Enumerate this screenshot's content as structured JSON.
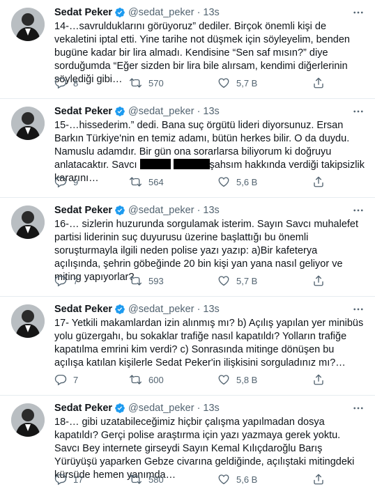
{
  "tweets": [
    {
      "name": "Sedat Peker",
      "handle": "@sedat_peker",
      "dot": "·",
      "time": "13s",
      "text_parts": [
        "14-…savrulduklarını görüyoruz” dediler. Birçok önemli kişi de vekaletini iptal etti. Yine tarihe not düşmek için söyleyelim, benden bugüne kadar bir lira almadı. Kendisine “Sen saf mısın?” diye sorduğumda “Eğer sizden bir lira bile alırsam, kendimi diğerlerinin söylediği gibi…"
      ],
      "replies": "8",
      "retweets": "570",
      "likes": "5,7 B"
    },
    {
      "name": "Sedat Peker",
      "handle": "@sedat_peker",
      "dot": "·",
      "time": "13s",
      "text_parts": [
        "15-…hissederim.” dedi. Bana suç örgütü lideri diyorsunuz. Ersan Barkın Türkiye'nin en temiz adamı, bütün herkes bilir. O da duydu. Namuslu adamdır. Bir gün ona sorarlarsa biliyorum ki doğruyu anlatacaktır. Savcı ",
        " ",
        "şahsım hakkında verdiği takipsizlik kararını…"
      ],
      "replies": "9",
      "retweets": "564",
      "likes": "5,6 B"
    },
    {
      "name": "Sedat Peker",
      "handle": "@sedat_peker",
      "dot": "·",
      "time": "13s",
      "text_parts": [
        "16-… sizlerin huzurunda sorgulamak isterim. Sayın Savcı muhalefet partisi liderinin suç duyurusu üzerine başlattığı bu önemli soruşturmayla ilgili neden polise yazı yazıp: a)Bir kafeterya açılışında, şehrin göbeğinde 20 bin kişi yan yana nasıl geliyor ve miting yapıyorlar?"
      ],
      "replies": "7",
      "retweets": "593",
      "likes": "5,7 B"
    },
    {
      "name": "Sedat Peker",
      "handle": "@sedat_peker",
      "dot": "·",
      "time": "13s",
      "text_parts": [
        "17- Yetkili makamlardan izin alınmış mı? b) Açılış yapılan yer minibüs yolu güzergahı, bu sokaklar trafiğe nasıl kapatıldı? Yolların trafiğe kapatılma emrini kim verdi? c) Sonrasında mitinge dönüşen bu açılışa katılan kişilerle Sedat Peker'in ilişkisini sorguladınız mı?…"
      ],
      "replies": "7",
      "retweets": "600",
      "likes": "5,8 B"
    },
    {
      "name": "Sedat Peker",
      "handle": "@sedat_peker",
      "dot": "·",
      "time": "13s",
      "text_parts": [
        "18-… gibi uzatabileceğimiz hiçbir çalışma yapılmadan dosya kapatıldı? Gerçi polise araştırma için yazı yazmaya gerek yoktu. Savcı Bey internete girseydi Sayın Kemal Kılıçdaroğlu Barış Yürüyüşü yaparken Gebze civarına geldiğinde, açılıştaki mitingdeki kürsüde hemen yanımda…"
      ],
      "replies": "17",
      "retweets": "580",
      "likes": "5,6 B"
    }
  ],
  "icons": {
    "verified": "verified-badge-icon",
    "more": "more-options-icon",
    "reply": "reply-icon",
    "retweet": "retweet-icon",
    "like": "like-heart-icon",
    "share": "share-icon"
  },
  "colors": {
    "verified_blue": "#1d9bf0",
    "text": "#0f1419",
    "secondary": "#536471",
    "divider": "#e6ecf0"
  }
}
